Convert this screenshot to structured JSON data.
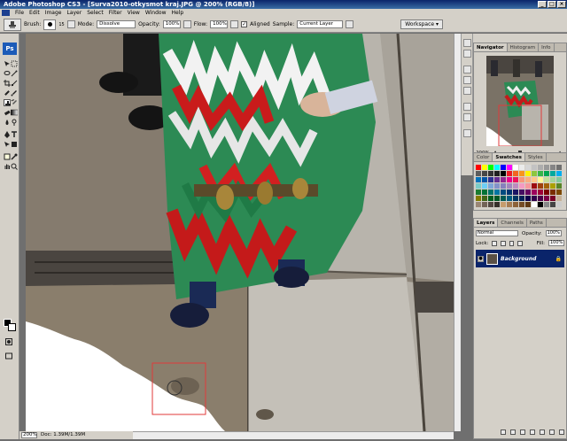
{
  "window": {
    "title": "Adobe Photoshop CS3 - [Surva2010-otkysmot kraj.JPG @ 200% (RGB/8)]",
    "buttons": [
      "_",
      "□",
      "×"
    ]
  },
  "menu": [
    "File",
    "Edit",
    "Image",
    "Layer",
    "Select",
    "Filter",
    "View",
    "Window",
    "Help"
  ],
  "options": {
    "brush_label": "Brush:",
    "brush_size": "15",
    "mode_label": "Mode:",
    "mode_value": "Dissolve",
    "opacity_label": "Opacity:",
    "opacity_value": "100%",
    "flow_label": "Flow:",
    "flow_value": "100%",
    "aligned_label": "Aligned",
    "sample_label": "Sample:",
    "sample_value": "Current Layer",
    "workspace_label": "Workspace ▾"
  },
  "tools": {
    "logo": "Ps"
  },
  "status": {
    "zoom": "200%",
    "doc": "Doc: 1.39M/1.39M"
  },
  "navigator": {
    "tabs": [
      "Navigator",
      "Histogram",
      "Info"
    ],
    "zoom": "200%"
  },
  "swatches": {
    "tabs": [
      "Color",
      "Swatches",
      "Styles"
    ],
    "colors": [
      "#ff0000",
      "#ffff00",
      "#00ff00",
      "#00ffff",
      "#0000ff",
      "#ff00ff",
      "#ffffff",
      "#ebebeb",
      "#d6d6d6",
      "#c2c2c2",
      "#adadad",
      "#999999",
      "#858585",
      "#707070",
      "#5c5c5c",
      "#474747",
      "#333333",
      "#1f1f1f",
      "#000000",
      "#ed1c24",
      "#f26522",
      "#f7941d",
      "#fff200",
      "#8dc63f",
      "#39b54a",
      "#00a651",
      "#00a99d",
      "#00aeef",
      "#0072bc",
      "#0054a6",
      "#2e3192",
      "#662d91",
      "#92278f",
      "#ec008c",
      "#ed145b",
      "#f7977a",
      "#f9ad81",
      "#fdc68a",
      "#fff799",
      "#c4df9b",
      "#a3d39c",
      "#82ca9d",
      "#7accc8",
      "#6dcff6",
      "#7da7d9",
      "#8393ca",
      "#8781bd",
      "#a187be",
      "#bd8cbf",
      "#f49ac2",
      "#f6989d",
      "#9e0b0f",
      "#a0410d",
      "#a36209",
      "#aba000",
      "#598527",
      "#1a7b30",
      "#007236",
      "#00746b",
      "#0076a3",
      "#004b80",
      "#003471",
      "#1b1464",
      "#440e62",
      "#630460",
      "#9e005d",
      "#9e0039",
      "#790000",
      "#7b2e00",
      "#7d4900",
      "#827b00",
      "#406618",
      "#005e20",
      "#005826",
      "#005952",
      "#005b7f",
      "#003663",
      "#002157",
      "#0d004c",
      "#32004b",
      "#4b0049",
      "#7b0046",
      "#7a0026",
      "#c7b299",
      "#998675",
      "#736357",
      "#534741",
      "#37302a",
      "#c69c6d",
      "#a67c52",
      "#8c6239",
      "#754c24",
      "#603913",
      "#fff",
      "#000",
      "#888",
      "#444",
      "#ccc"
    ]
  },
  "layers": {
    "tabs": [
      "Layers",
      "Channels",
      "Paths"
    ],
    "blend_mode": "Normal",
    "opacity_label": "Opacity:",
    "opacity_value": "100%",
    "lock_label": "Lock:",
    "fill_label": "Fill:",
    "fill_value": "100%",
    "layer_name": "Background"
  }
}
